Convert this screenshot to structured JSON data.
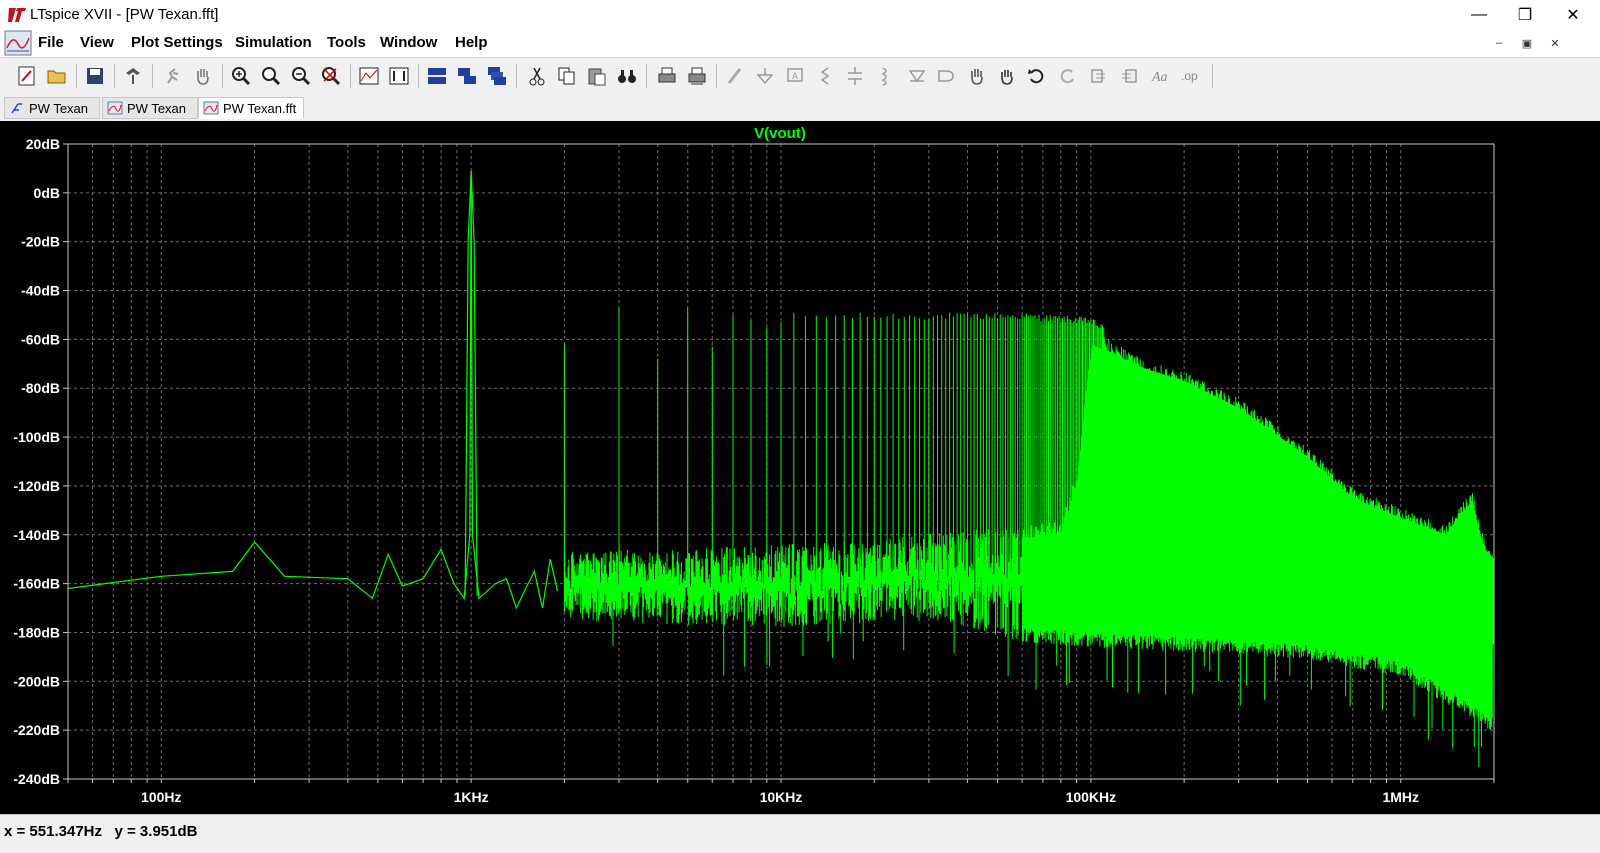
{
  "window": {
    "title": "LTspice XVII - [PW Texan.fft]",
    "minimize": "—",
    "maximize": "❐",
    "close": "✕"
  },
  "menu": {
    "items": [
      "File",
      "View",
      "Plot Settings",
      "Simulation",
      "Tools",
      "Window",
      "Help"
    ]
  },
  "mdi": {
    "minimize": "–",
    "restore": "▣",
    "close": "✕"
  },
  "toolbar": {
    "buttons": [
      "new-schematic-icon",
      "open-folder-icon",
      "save-icon",
      "control-panel-icon",
      "run-icon",
      "pan-icon",
      "zoom-in-icon",
      "zoom-area-icon",
      "zoom-out-icon",
      "zoom-fit-icon",
      "autorange-icon",
      "autorange-y-icon",
      "tile-horizontal-icon",
      "tile-vertical-icon",
      "cascade-icon",
      "cut-icon",
      "copy-icon",
      "paste-icon",
      "find-icon",
      "print-icon",
      "print-preview-icon",
      "wire-icon",
      "ground-icon",
      "label-icon",
      "resistor-icon",
      "capacitor-icon",
      "inductor-icon",
      "diode-icon",
      "component-icon",
      "move-icon",
      "drag-icon",
      "undo-icon",
      "redo-icon",
      "rotate-icon",
      "mirror-icon",
      "text-icon",
      "spice-directive-icon"
    ]
  },
  "tabs": [
    {
      "label": "PW Texan",
      "icon": "schematic-icon"
    },
    {
      "label": "PW Texan",
      "icon": "waveform-icon"
    },
    {
      "label": "PW Texan.fft",
      "icon": "fft-icon"
    }
  ],
  "status": {
    "text": "x = 551.347Hz   y = 3.951dB"
  },
  "chart_data": {
    "type": "line",
    "title": "V(vout)",
    "xlabel": "",
    "ylabel": "",
    "xscale": "log",
    "xlim": [
      50,
      2000000
    ],
    "ylim": [
      -240,
      20
    ],
    "x_ticks": [
      "100Hz",
      "1KHz",
      "10KHz",
      "100KHz",
      "1MHz"
    ],
    "y_ticks": [
      "20dB",
      "0dB",
      "-20dB",
      "-40dB",
      "-60dB",
      "-80dB",
      "-100dB",
      "-120dB",
      "-140dB",
      "-160dB",
      "-180dB",
      "-200dB",
      "-220dB",
      "-240dB"
    ],
    "grid": true,
    "line_color": "#00ff00",
    "grid_color": "#6e6e6e",
    "axis_color": "#c8c8c8",
    "fundamental": {
      "freq": 1000,
      "db": 9
    },
    "harmonics": [
      {
        "freq": 2000,
        "db": -62
      },
      {
        "freq": 3000,
        "db": -47
      },
      {
        "freq": 4000,
        "db": -68
      },
      {
        "freq": 5000,
        "db": -47
      },
      {
        "freq": 6000,
        "db": -63
      },
      {
        "freq": 7000,
        "db": -50
      },
      {
        "freq": 8000,
        "db": -52
      },
      {
        "freq": 9000,
        "db": -55
      },
      {
        "freq": 10000,
        "db": -53
      },
      {
        "freq": 20000,
        "db": -52
      },
      {
        "freq": 50000,
        "db": -52
      },
      {
        "freq": 100000,
        "db": -53
      },
      {
        "freq": 200000,
        "db": -78
      }
    ],
    "envelope_top": [
      [
        50,
        -162
      ],
      [
        100,
        -157
      ],
      [
        170,
        -155
      ],
      [
        200,
        -143
      ],
      [
        250,
        -158
      ],
      [
        400,
        -158
      ],
      [
        500,
        -165
      ],
      [
        550,
        -148
      ],
      [
        600,
        -160
      ],
      [
        800,
        -146
      ],
      [
        950,
        -165
      ],
      [
        1000,
        9
      ],
      [
        1100,
        -165
      ],
      [
        2000,
        -150
      ],
      [
        5000,
        -150
      ],
      [
        10000,
        -146
      ],
      [
        30000,
        -145
      ],
      [
        60000,
        -52
      ],
      [
        100000,
        -53
      ],
      [
        150000,
        -70
      ],
      [
        200000,
        -77
      ],
      [
        300000,
        -88
      ],
      [
        500000,
        -108
      ],
      [
        700000,
        -125
      ],
      [
        1000000,
        -133
      ],
      [
        1500000,
        -137
      ],
      [
        1700000,
        -125
      ],
      [
        2000000,
        -150
      ]
    ],
    "envelope_bottom": [
      [
        3000,
        -170
      ],
      [
        10000,
        -172
      ],
      [
        30000,
        -168
      ],
      [
        60000,
        -178
      ],
      [
        100000,
        -180
      ],
      [
        200000,
        -182
      ],
      [
        500000,
        -185
      ],
      [
        1000000,
        -192
      ],
      [
        2000000,
        -215
      ]
    ]
  }
}
